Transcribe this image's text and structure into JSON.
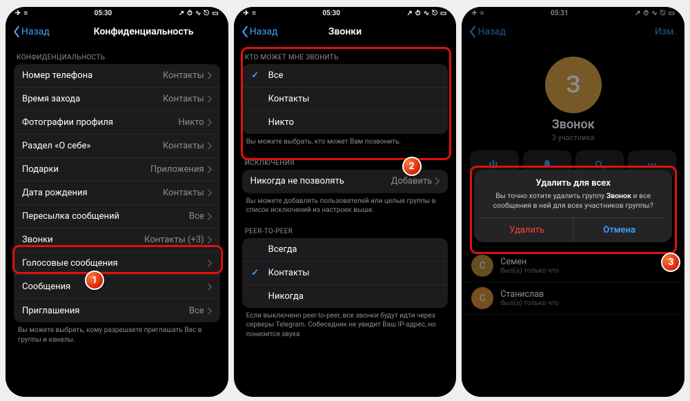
{
  "status": {
    "signal": "✈︎",
    "wifi": "⋮",
    "time_a": "05:30",
    "time_b": "05:30",
    "time_c": "05:31"
  },
  "nav_back": "Назад",
  "nav_edit": "Изм.",
  "s1": {
    "title": "Конфиденциальность",
    "header": "КОНФИДЕНЦИАЛЬНОСТЬ",
    "rows": [
      {
        "l": "Номер телефона",
        "v": "Контакты"
      },
      {
        "l": "Время захода",
        "v": "Контакты"
      },
      {
        "l": "Фотографии профиля",
        "v": "Никто"
      },
      {
        "l": "Раздел «О себе»",
        "v": "Контакты"
      },
      {
        "l": "Подарки",
        "v": "Приложения"
      },
      {
        "l": "Дата рождения",
        "v": "Контакты"
      },
      {
        "l": "Пересылка сообщений",
        "v": "Все"
      },
      {
        "l": "Звонки",
        "v": "Контакты (+3)"
      },
      {
        "l": "Голосовые сообщения",
        "v": ""
      },
      {
        "l": "Сообщения",
        "v": ""
      },
      {
        "l": "Приглашения",
        "v": "Все"
      }
    ],
    "footer": "Вы можете выбрать, кому разрешаете приглашать Вас в группы и каналы."
  },
  "s2": {
    "title": "Звонки",
    "h1": "КТО МОЖЕТ МНЕ ЗВОНИТЬ",
    "opts": [
      "Все",
      "Контакты",
      "Никто"
    ],
    "f1": "Вы можете выбрать, кто может Вам позвонить.",
    "h2": "ИСКЛЮЧЕНИЯ",
    "exc_l": "Никогда не позволять",
    "exc_v": "Добавить",
    "f2": "Вы можете добавлять пользователей или целые группы в список исключений из настроек выше.",
    "h3": "PEER-TO-PEER",
    "p2p": [
      "Всегда",
      "Контакты",
      "Никогда"
    ],
    "f3": "Если выключено peer-to-peer, все звонки будут идти через серверы Telegram. Собеседник не увидит Ваш IP-адрес, но понизится звука"
  },
  "s3": {
    "avatar": "З",
    "name": "Звонок",
    "sub": "3 участника",
    "alert_title": "Удалить для всех",
    "alert_msg_pre": "Вы точно хотите удалить группу ",
    "alert_msg_bold": "Звонок",
    "alert_msg_post": " и все сообщения в ней для всех участников группы?",
    "btn_del": "Удалить",
    "btn_cancel": "Отмена",
    "members": [
      {
        "i": "С",
        "c": "#b88f3f",
        "n": "Семен",
        "s": "был(а) только что"
      },
      {
        "i": "С",
        "c": "#d98f3a",
        "n": "Станислав",
        "s": "был(а) только что"
      }
    ]
  }
}
